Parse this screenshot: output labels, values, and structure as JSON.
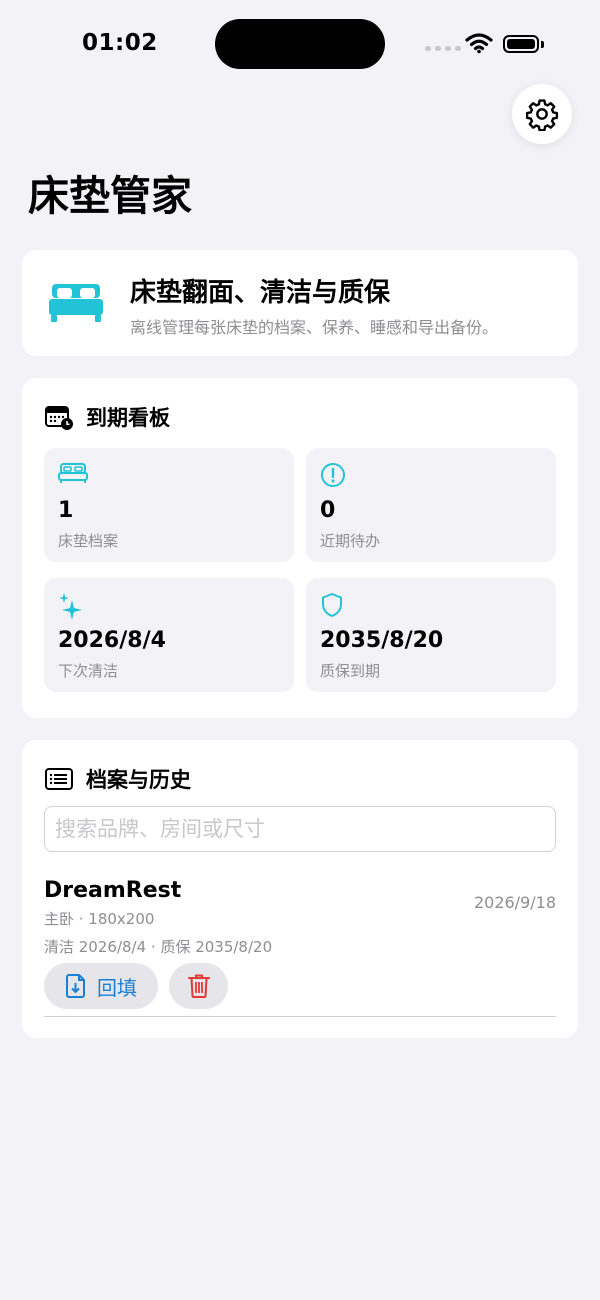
{
  "status_bar": {
    "time": "01:02"
  },
  "header": {
    "title": "床垫管家",
    "settings_icon": "gear-icon"
  },
  "hero": {
    "title": "床垫翻面、清洁与质保",
    "subtitle": "离线管理每张床垫的档案、保养、睡感和导出备份。",
    "icon": "bed-icon",
    "accent": "#22c3d6"
  },
  "dashboard": {
    "title": "到期看板",
    "icon": "calendar-clock-icon",
    "tiles": [
      {
        "icon": "bed-icon",
        "value": "1",
        "label": "床垫档案"
      },
      {
        "icon": "exclamation-circle-icon",
        "value": "0",
        "label": "近期待办"
      },
      {
        "icon": "sparkles-icon",
        "value": "2026/8/4",
        "label": "下次清洁"
      },
      {
        "icon": "shield-icon",
        "value": "2035/8/20",
        "label": "质保到期"
      }
    ]
  },
  "records": {
    "title": "档案与历史",
    "icon": "list-icon",
    "search_placeholder": "搜索品牌、房间或尺寸",
    "items": [
      {
        "name": "DreamRest",
        "meta": "主卧 · 180x200",
        "dates": "清洁 2026/8/4 · 质保 2035/8/20",
        "date": "2026/9/18",
        "fill_label": "回填"
      }
    ]
  },
  "colors": {
    "accent": "#22c3d6",
    "link_blue": "#1a7fd6",
    "danger": "#e53935",
    "background": "#f2f2f7"
  }
}
